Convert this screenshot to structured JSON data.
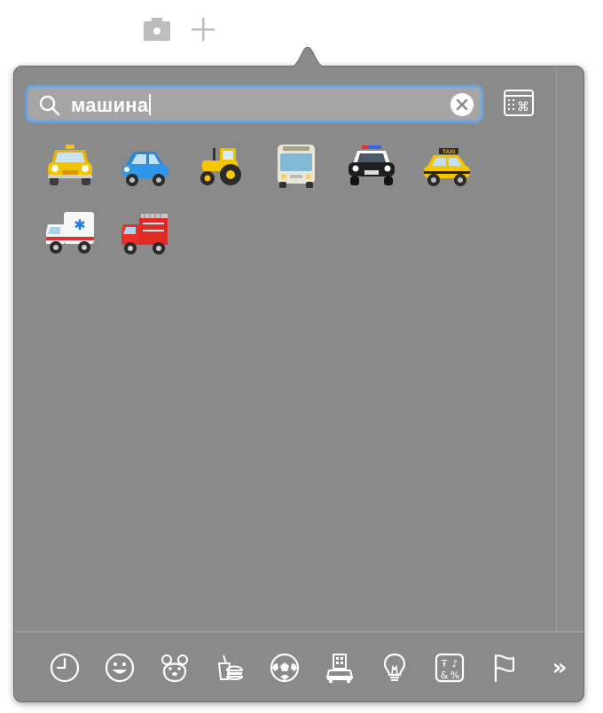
{
  "search": {
    "query": "машина"
  },
  "emoji_results": [
    {
      "icon": "taxi-icon"
    },
    {
      "icon": "car-icon"
    },
    {
      "icon": "tractor-icon"
    },
    {
      "icon": "bus-icon"
    },
    {
      "icon": "police-car-icon"
    },
    {
      "icon": "taxi-side-icon",
      "badge": "TAXI"
    },
    {
      "icon": "ambulance-icon"
    },
    {
      "icon": "fire-engine-icon"
    }
  ],
  "categories": [
    {
      "icon": "recent-clock-icon"
    },
    {
      "icon": "smileys-icon"
    },
    {
      "icon": "animals-icon"
    },
    {
      "icon": "food-icon"
    },
    {
      "icon": "activity-icon"
    },
    {
      "icon": "travel-icon"
    },
    {
      "icon": "objects-icon"
    },
    {
      "icon": "symbols-icon"
    },
    {
      "icon": "flags-icon"
    }
  ],
  "more_label": "»",
  "colors": {
    "panel": "#8a8a8a",
    "focus": "#6aa8e8",
    "text": "#ffffff"
  }
}
